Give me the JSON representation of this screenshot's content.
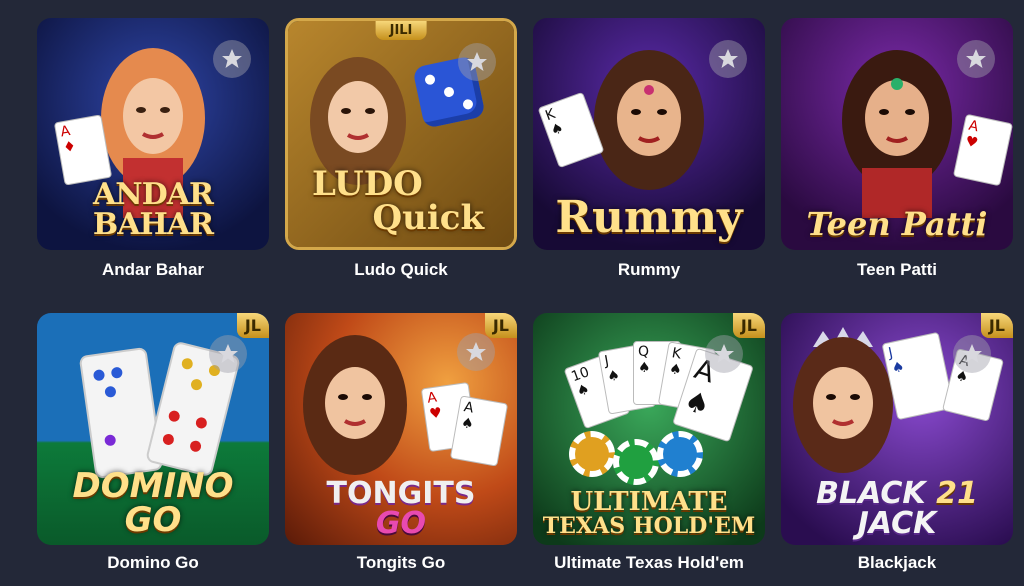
{
  "games": [
    {
      "title": "Andar Bahar",
      "logo": "ANDAR BAHAR",
      "badge": "",
      "bg1": "#1d2a6a",
      "bg2": "#0d1440",
      "hair": "#e58a4e"
    },
    {
      "title": "Ludo Quick",
      "logo_line1": "LUDO",
      "logo_line2": "Quick",
      "badge": "JILI",
      "bg1": "#b8862d",
      "bg2": "#6e4a12",
      "hair": "#7a4a22"
    },
    {
      "title": "Rummy",
      "logo": "Rummy",
      "badge": "",
      "bg1": "#3b1a70",
      "bg2": "#170a35",
      "hair": "#4a2616"
    },
    {
      "title": "Teen Patti",
      "logo": "Teen Patti",
      "badge": "",
      "bg1": "#5a1a7a",
      "bg2": "#2a0a40",
      "hair": "#3a1a10"
    },
    {
      "title": "Domino Go",
      "logo_line1": "DOMINO",
      "logo_line2": "GO",
      "badge": "JL",
      "bg1": "#1b6fb8",
      "bg2": "#0d7a3a",
      "hair": ""
    },
    {
      "title": "Tongits Go",
      "logo_line1": "TONGITS",
      "logo_line2": "GO",
      "badge": "JL",
      "bg1": "#e07a20",
      "bg2": "#7a2a10",
      "hair": "#5a2a14"
    },
    {
      "title": "Ultimate Texas Hold'em",
      "logo_line1": "ULTIMATE",
      "logo_line2": "TEXAS HOLD'EM",
      "badge": "JL",
      "bg1": "#2a8a4a",
      "bg2": "#0d3a1a",
      "hair": ""
    },
    {
      "title": "Blackjack",
      "logo_line1": "BLACK",
      "logo_line2": "JACK",
      "logo_num": "21",
      "badge": "JL",
      "bg1": "#6a2aa8",
      "bg2": "#2a0d50",
      "hair": "#5a2a18"
    }
  ],
  "icons": {
    "favorite": "star-icon"
  },
  "colors": {
    "page_bg": "#232838",
    "title_text": "#ffffff",
    "star_fill": "#d8d8de"
  }
}
